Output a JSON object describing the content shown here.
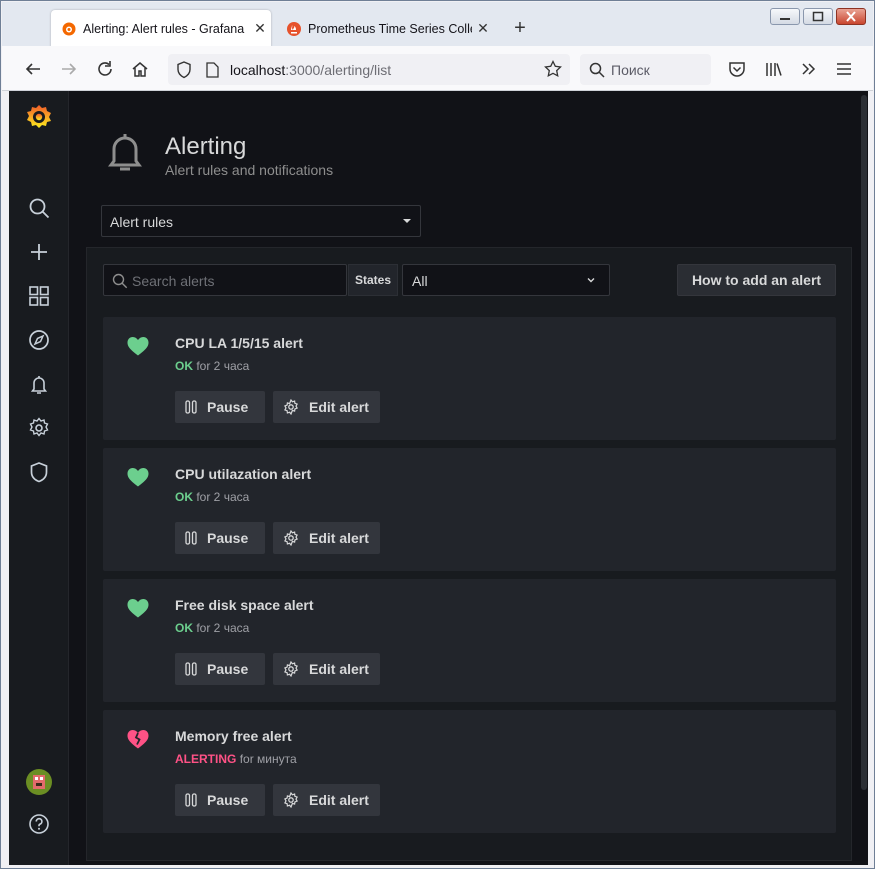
{
  "browser": {
    "tabs": [
      {
        "label": "Alerting: Alert rules - Grafana",
        "active": true,
        "close": "✕"
      },
      {
        "label": "Prometheus Time Series Collect",
        "active": false,
        "close": "✕"
      }
    ],
    "new_tab": "+",
    "url_host": "localhost",
    "url_rest": ":3000/alerting/list",
    "search_placeholder": "Поиск"
  },
  "sidebar": {
    "items": [
      "grafana-logo-icon",
      "search-icon",
      "plus-icon",
      "dashboards-icon",
      "explore-icon",
      "alerting-icon",
      "configuration-icon",
      "server-admin-icon",
      "user-avatar",
      "help-icon"
    ]
  },
  "header": {
    "title": "Alerting",
    "subtitle": "Alert rules and notifications",
    "view_select": "Alert rules"
  },
  "toolbar": {
    "search_placeholder": "Search alerts",
    "states_label": "States",
    "states_value": "All",
    "howto_label": "How to add an alert"
  },
  "alerts": [
    {
      "name": "CPU LA 1/5/15 alert",
      "state": "OK",
      "duration": "for 2 часа",
      "pause_label": "Pause",
      "edit_label": "Edit alert"
    },
    {
      "name": "CPU utilazation alert",
      "state": "OK",
      "duration": "for 2 часа",
      "pause_label": "Pause",
      "edit_label": "Edit alert"
    },
    {
      "name": "Free disk space alert",
      "state": "OK",
      "duration": "for 2 часа",
      "pause_label": "Pause",
      "edit_label": "Edit alert"
    },
    {
      "name": "Memory free alert",
      "state": "ALERTING",
      "duration": "for минута",
      "pause_label": "Pause",
      "edit_label": "Edit alert"
    }
  ],
  "colors": {
    "ok": "#6ccf8e",
    "alerting": "#ff5286",
    "background": "#111217",
    "panel": "#181b1f",
    "card": "#22252b"
  }
}
